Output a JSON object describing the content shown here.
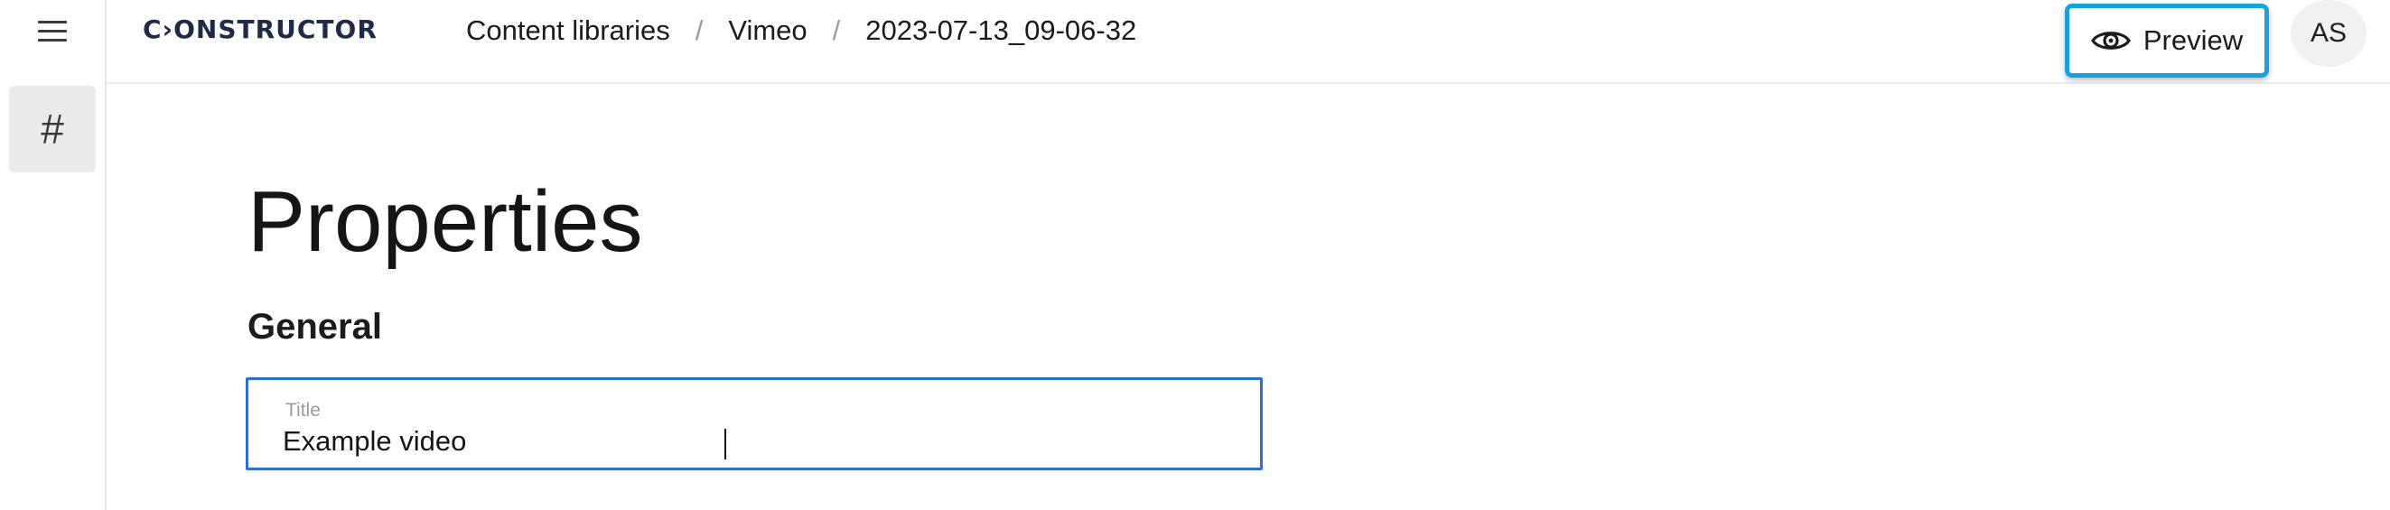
{
  "rail": {
    "menu_icon": "hamburger-menu-icon",
    "active_item": "#"
  },
  "header": {
    "logo": "C›ONSTRUCTOR",
    "breadcrumb": [
      "Content libraries",
      "Vimeo",
      "2023-07-13_09-06-32"
    ],
    "separator": "/",
    "preview_label": "Preview",
    "preview_icon": "eye-icon",
    "avatar_initials": "AS"
  },
  "main": {
    "title": "Properties",
    "section": "General",
    "fields": [
      {
        "label": "Title",
        "value": "Example video"
      }
    ]
  },
  "colors": {
    "accent_focus": "#2f6fd3",
    "highlight": "#16a3dd",
    "logo": "#1f2a44"
  }
}
